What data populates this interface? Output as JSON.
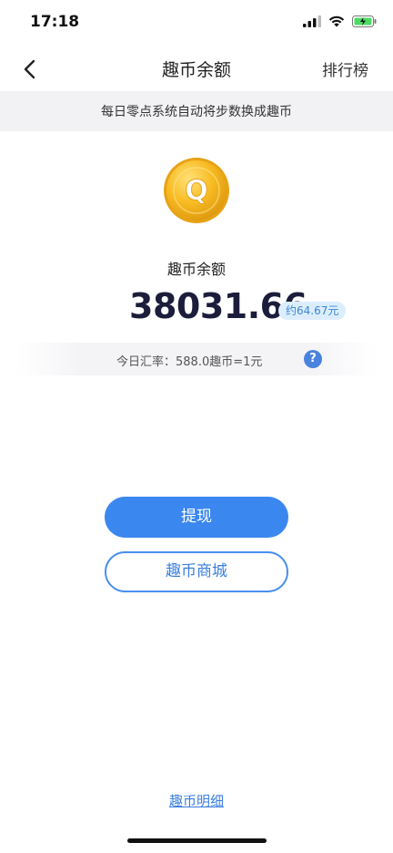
{
  "status_bar": {
    "time": "17:18"
  },
  "nav": {
    "title": "趣币余额",
    "right_action": "排行榜"
  },
  "notice": "每日零点系统自动将步数换成趣币",
  "coin": {
    "letter": "Q"
  },
  "balance": {
    "label": "趣币余额",
    "amount": "38031.66",
    "approx": "约64.67元"
  },
  "rate": {
    "text": "今日汇率：588.0趣币=1元",
    "help_symbol": "?"
  },
  "buttons": {
    "withdraw": "提现",
    "mall": "趣币商城"
  },
  "footer": {
    "detail_link": "趣币明细"
  },
  "colors": {
    "primary": "#3b87f0",
    "amount": "#1c1d3b",
    "coin_gold": "#f5b21a",
    "battery": "#4cd964"
  }
}
